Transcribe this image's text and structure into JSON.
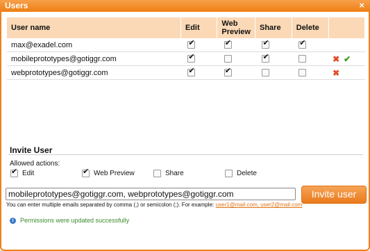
{
  "window": {
    "title": "Users",
    "close_glyph": "×"
  },
  "table": {
    "headers": [
      "User name",
      "Edit",
      "Web Preview",
      "Share",
      "Delete"
    ],
    "rows": [
      {
        "user": "max@exadel.com",
        "edit": true,
        "web_preview": true,
        "share": true,
        "delete": true,
        "actions": []
      },
      {
        "user": "mobileprototypes@gotiggr.com",
        "edit": true,
        "web_preview": false,
        "share": true,
        "delete": false,
        "actions": [
          "remove-icon",
          "confirm-icon"
        ]
      },
      {
        "user": "webprototypes@gotiggr.com",
        "edit": true,
        "web_preview": true,
        "share": false,
        "delete": false,
        "actions": [
          "remove-icon"
        ]
      }
    ]
  },
  "invite": {
    "title": "Invite User",
    "allowed_label": "Allowed actions:",
    "permissions": [
      {
        "label": "Edit",
        "checked": true
      },
      {
        "label": "Web Preview",
        "checked": true
      },
      {
        "label": "Share",
        "checked": false
      },
      {
        "label": "Delete",
        "checked": false
      }
    ],
    "email_value": "mobileprototypes@gotiggr.com, webprototypes@gotiggr.com",
    "button_label": "Invite user",
    "hint_text": "You can enter multiple emails separated by comma (,) or semicolon (;). For example: ",
    "hint_example": "user1@mail.com, user2@mail.com"
  },
  "status": {
    "message": "Permissions were updated successfully",
    "icon": "info-icon"
  },
  "colors": {
    "accent": "#f08a24",
    "header_bg": "#fbd9b6",
    "success": "#3a8a2a",
    "remove": "#e0502a",
    "confirm": "#3b9a18"
  }
}
